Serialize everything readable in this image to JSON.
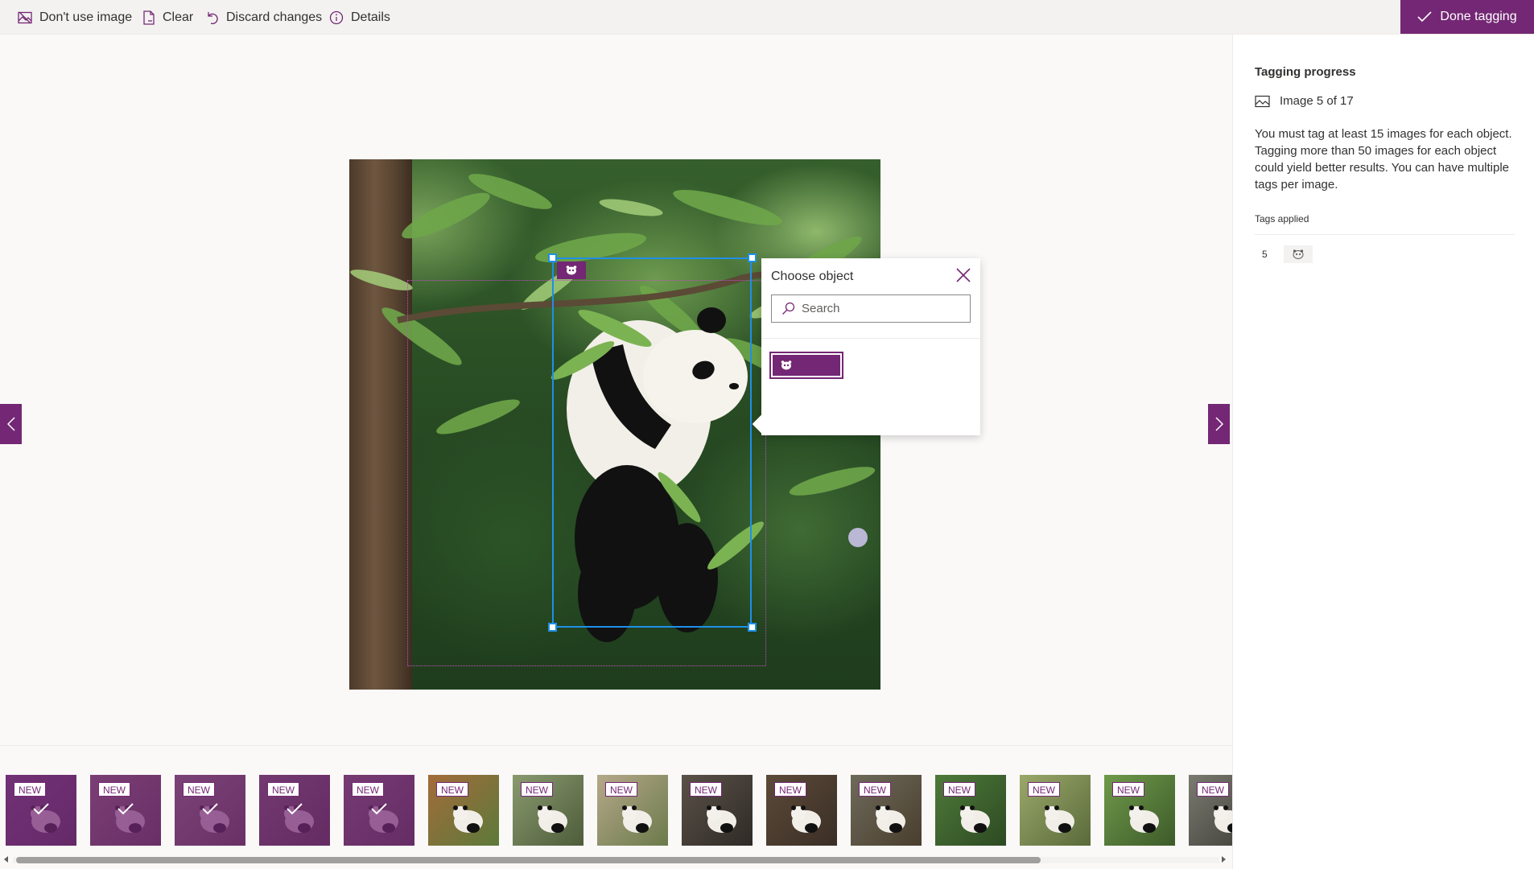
{
  "toolbar": {
    "dont_use_label": "Don't use image",
    "clear_label": "Clear",
    "discard_label": "Discard changes",
    "details_label": "Details",
    "done_label": "Done tagging",
    "accent": "#742774"
  },
  "popup": {
    "title": "Choose object",
    "search_placeholder": "Search",
    "selected_option_icon": "panda-icon"
  },
  "right_panel": {
    "title": "Tagging progress",
    "image_count": "Image 5 of 17",
    "description": "You must tag at least 15 images for each object. Tagging more than 50 images for each object could yield better results. You can have multiple tags per image.",
    "tags_label": "Tags applied",
    "tag_rows": [
      {
        "count": "5",
        "icon": "panda-icon"
      }
    ]
  },
  "filmstrip": {
    "badge_label": "NEW",
    "thumbnails": [
      {
        "badge": "NEW",
        "tagged": true
      },
      {
        "badge": "NEW",
        "tagged": true
      },
      {
        "badge": "NEW",
        "tagged": true
      },
      {
        "badge": "NEW",
        "tagged": true
      },
      {
        "badge": "NEW",
        "tagged": true
      },
      {
        "badge": "NEW",
        "tagged": false
      },
      {
        "badge": "NEW",
        "tagged": false
      },
      {
        "badge": "NEW",
        "tagged": false
      },
      {
        "badge": "NEW",
        "tagged": false
      },
      {
        "badge": "NEW",
        "tagged": false
      },
      {
        "badge": "NEW",
        "tagged": false
      },
      {
        "badge": "NEW",
        "tagged": false
      },
      {
        "badge": "NEW",
        "tagged": false
      },
      {
        "badge": "NEW",
        "tagged": false
      },
      {
        "badge": "NEW",
        "tagged": false
      }
    ]
  }
}
